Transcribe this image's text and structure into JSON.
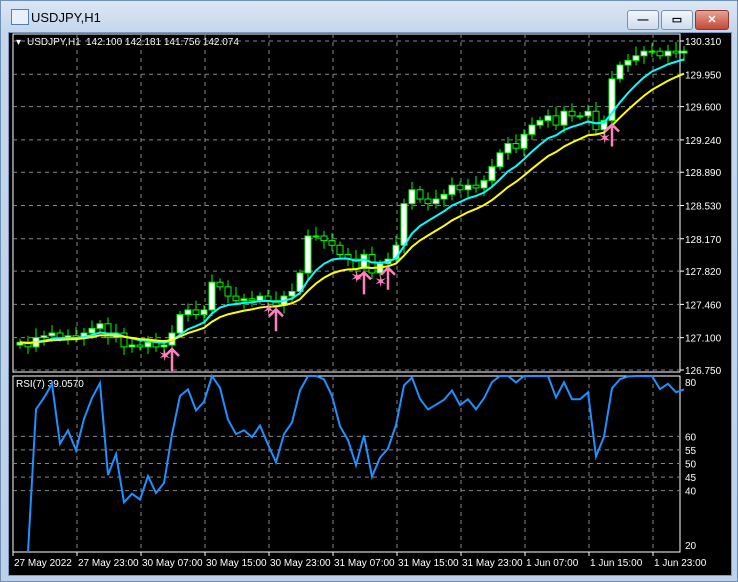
{
  "window": {
    "title": "USDJPY,H1",
    "buttons": [
      "minimize",
      "maximize",
      "close"
    ]
  },
  "chart_header": {
    "symbol": "USDJPY,H1",
    "ohlc": "142.100 142.181 141.756 142.074"
  },
  "rsi_label": "RSI(7) 39.0570",
  "colors": {
    "background": "#000000",
    "bull_body": "#ffffff",
    "candle_outline": "#00ff00",
    "ma_fast": "#00ffff",
    "ma_slow": "#ffff00",
    "rsi_line": "#1e90ff",
    "signal": "#ff80c0"
  },
  "chart_data": {
    "type": "candlestick",
    "price_axis_labels": [
      "130.310",
      "129.950",
      "129.600",
      "129.240",
      "128.890",
      "128.530",
      "128.170",
      "127.820",
      "127.460",
      "127.100",
      "126.750"
    ],
    "ylim": [
      126.75,
      130.31
    ],
    "time_labels": [
      "27 May 2022",
      "27 May 23:00",
      "30 May 07:00",
      "30 May 15:00",
      "30 May 23:00",
      "31 May 07:00",
      "31 May 15:00",
      "31 May 23:00",
      "1 Jun 07:00",
      "1 Jun 15:00",
      "1 Jun 23:00"
    ],
    "closes": [
      127.05,
      127.0,
      127.1,
      127.12,
      127.15,
      127.1,
      127.12,
      127.1,
      127.15,
      127.2,
      127.25,
      127.1,
      127.15,
      127.0,
      127.02,
      127.0,
      127.05,
      127.0,
      127.02,
      127.15,
      127.35,
      127.4,
      127.35,
      127.4,
      127.7,
      127.65,
      127.55,
      127.5,
      127.52,
      127.5,
      127.55,
      127.5,
      127.45,
      127.55,
      127.6,
      127.8,
      128.2,
      128.2,
      128.15,
      128.1,
      128.0,
      127.95,
      127.85,
      128.0,
      127.8,
      127.9,
      127.95,
      128.1,
      128.55,
      128.7,
      128.6,
      128.55,
      128.6,
      128.65,
      128.75,
      128.7,
      128.75,
      128.72,
      128.8,
      128.95,
      129.1,
      129.2,
      129.15,
      129.3,
      129.4,
      129.45,
      129.5,
      129.4,
      129.55,
      129.5,
      129.5,
      129.55,
      129.35,
      129.45,
      129.9,
      130.05,
      130.1,
      130.15,
      130.2,
      130.2,
      130.15,
      130.2,
      130.18,
      130.2
    ],
    "ma_periods": {
      "fast": 8,
      "slow": 14
    },
    "signals": [
      {
        "bar": 18,
        "type": "star"
      },
      {
        "bar": 19,
        "type": "arrow"
      },
      {
        "bar": 31,
        "type": "star"
      },
      {
        "bar": 32,
        "type": "arrow"
      },
      {
        "bar": 42,
        "type": "star"
      },
      {
        "bar": 43,
        "type": "arrow"
      },
      {
        "bar": 45,
        "type": "star"
      },
      {
        "bar": 46,
        "type": "arrow"
      },
      {
        "bar": 73,
        "type": "star"
      },
      {
        "bar": 74,
        "type": "arrow"
      }
    ],
    "rsi": {
      "period": 7,
      "levels": [
        "80",
        "60",
        "55",
        "50",
        "45",
        "40",
        "20"
      ],
      "ylim": [
        20,
        80
      ]
    }
  }
}
